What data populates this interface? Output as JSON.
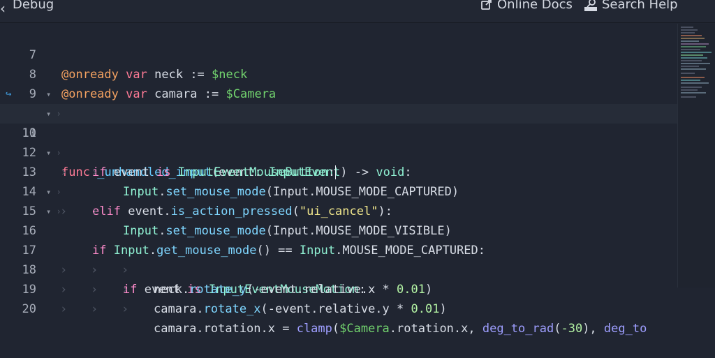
{
  "topbar": {
    "debug_label": "Debug",
    "online_docs_label": "Online Docs",
    "search_help_label": "Search Help",
    "collapse_icon": "chevron-left-icon"
  },
  "editor": {
    "lines": [
      {
        "num": "7"
      },
      {
        "num": "8"
      },
      {
        "num": "9"
      },
      {
        "num": "10"
      },
      {
        "num": "11"
      },
      {
        "num": "12"
      },
      {
        "num": "13"
      },
      {
        "num": "14"
      },
      {
        "num": "15"
      },
      {
        "num": "16"
      },
      {
        "num": "17"
      },
      {
        "num": "18"
      },
      {
        "num": "19"
      },
      {
        "num": "20"
      }
    ],
    "code": {
      "l7": {
        "annot": "@onready",
        "kw": "var",
        "name": "neck",
        "op": ":=",
        "node": "$neck"
      },
      "l8": {
        "annot": "@onready",
        "kw": "var",
        "name": "camara",
        "op": ":=",
        "node": "$Camera"
      },
      "l10": {
        "kw": "func",
        "fname": "_unhandled_input",
        "open": "(event: ",
        "type": "InputEvent",
        "close": ") -> ",
        "ret": "void",
        "colon": ":"
      },
      "l11": {
        "kw": "if",
        "a": "event",
        "kw2": "is",
        "type": "InputEventMouseButton",
        "colon": ":"
      },
      "l12": {
        "obj": "Input",
        "dot": ".",
        "method": "set_mouse_mode",
        "args": "(Input.MOUSE_MODE_CAPTURED)"
      },
      "l13": {
        "kw": "elif",
        "a": "event.",
        "method": "is_action_pressed",
        "open": "(",
        "str": "\"ui_cancel\"",
        "close": "):"
      },
      "l14": {
        "obj": "Input",
        "dot": ".",
        "method": "set_mouse_mode",
        "args": "(Input.MOUSE_MODE_VISIBLE)"
      },
      "l15": {
        "kw": "if",
        "obj": "Input",
        "dot": ".",
        "method": "get_mouse_mode",
        "mid": "() == ",
        "obj2": "Input",
        "rest": ".MOUSE_MODE_CAPTURED:"
      },
      "l16": {
        "kw": "if",
        "a": "event",
        "kw2": "is",
        "type": "InputEventMouseMotion",
        "colon": ":"
      },
      "l17": {
        "obj": "neck.",
        "method": "rotate_y",
        "args": "(-event.relative.x * ",
        "num": "0.01",
        "close": ")"
      },
      "l18": {
        "obj": "camara.",
        "method": "rotate_x",
        "args": "(-event.relative.y * ",
        "num": "0.01",
        "close": ")"
      },
      "l19": {
        "a": "camara.rotation.x = ",
        "fn": "clamp",
        "open": "(",
        "node": "$Camera",
        "mid": ".rotation.x, ",
        "fn2": "deg_to_rad",
        "p": "(",
        "num": "-30",
        "p2": "), ",
        "fn3": "deg_to"
      }
    }
  },
  "colors": {
    "background": "#202531",
    "keyword": "#ff7b96",
    "annotation": "#f4a261",
    "node_path": "#72d36e",
    "type": "#8ff0d2",
    "function": "#66ccff",
    "string": "#f0e68c",
    "number": "#b4f4a4"
  }
}
